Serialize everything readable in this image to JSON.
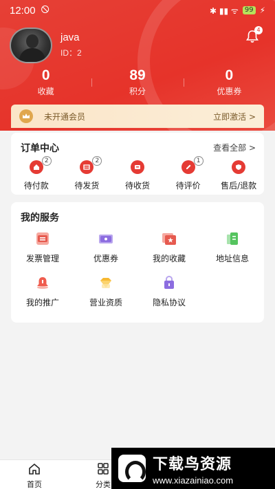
{
  "status_bar": {
    "time": "12:00",
    "left_icons": "🛇",
    "battery": "99",
    "right_icons": "✱ ▮▮ ᯤ"
  },
  "profile": {
    "username": "java",
    "user_id": "ID：2",
    "notification_count": "4"
  },
  "stats": [
    {
      "value": "0",
      "label": "收藏"
    },
    {
      "value": "89",
      "label": "积分"
    },
    {
      "value": "0",
      "label": "优惠券"
    }
  ],
  "member": {
    "status": "未开通会员",
    "action": "立即激活 >"
  },
  "orders": {
    "title": "订单中心",
    "view_all": "查看全部 >",
    "items": [
      {
        "label": "待付款",
        "badge": "2",
        "icon": "house-icon"
      },
      {
        "label": "待发货",
        "badge": "2",
        "icon": "truck-icon"
      },
      {
        "label": "待收货",
        "badge": "",
        "icon": "package-icon"
      },
      {
        "label": "待评价",
        "badge": "1",
        "icon": "pencil-icon"
      },
      {
        "label": "售后/退款",
        "badge": "",
        "icon": "shield-icon"
      }
    ]
  },
  "services": {
    "title": "我的服务",
    "items": [
      {
        "label": "发票管理",
        "icon": "invoice-icon",
        "color": "#e65a4f"
      },
      {
        "label": "优惠券",
        "icon": "coupon-icon",
        "color": "#8c6de0"
      },
      {
        "label": "我的收藏",
        "icon": "favorite-icon",
        "color": "#e65a4f"
      },
      {
        "label": "地址信息",
        "icon": "address-icon",
        "color": "#55c45f"
      },
      {
        "label": "我的推广",
        "icon": "bell-promo-icon",
        "color": "#ef5c4e"
      },
      {
        "label": "营业资质",
        "icon": "diamond-icon",
        "color": "#f7b831"
      },
      {
        "label": "隐私协议",
        "icon": "lock-icon",
        "color": "#8c6de0"
      }
    ]
  },
  "tabbar": {
    "home": "首页",
    "category": "分类"
  },
  "watermark": {
    "title": "下载鸟资源",
    "url": "www.xiazainiao.com"
  },
  "colors": {
    "brand": "#e6332a",
    "member_bg": "#fbe5c8"
  }
}
